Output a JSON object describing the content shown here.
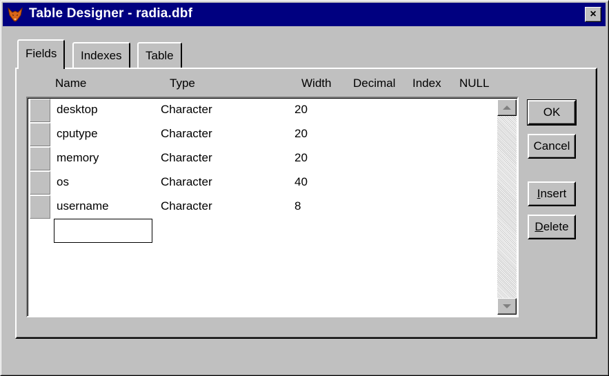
{
  "window": {
    "title": "Table Designer - radia.dbf",
    "close_glyph": "×"
  },
  "tabs": [
    {
      "label": "Fields",
      "active": true
    },
    {
      "label": "Indexes",
      "active": false
    },
    {
      "label": "Table",
      "active": false
    }
  ],
  "columns": {
    "name": "Name",
    "type": "Type",
    "width": "Width",
    "decimal": "Decimal",
    "index": "Index",
    "null": "NULL"
  },
  "fields": [
    {
      "name": "desktop",
      "type": "Character",
      "width": "20"
    },
    {
      "name": "cputype",
      "type": "Character",
      "width": "20"
    },
    {
      "name": "memory",
      "type": "Character",
      "width": "20"
    },
    {
      "name": "os",
      "type": "Character",
      "width": "40"
    },
    {
      "name": "username",
      "type": "Character",
      "width": "8"
    }
  ],
  "new_field": {
    "name": ""
  },
  "buttons": {
    "ok": "OK",
    "cancel": "Cancel",
    "insert_key": "I",
    "insert_rest": "nsert",
    "delete_key": "D",
    "delete_rest": "elete"
  },
  "colors": {
    "titlebar": "#000080",
    "face": "#c0c0c0",
    "grid_bg": "#ffffff"
  },
  "icons": {
    "app": "fox-icon",
    "close": "close-icon"
  }
}
